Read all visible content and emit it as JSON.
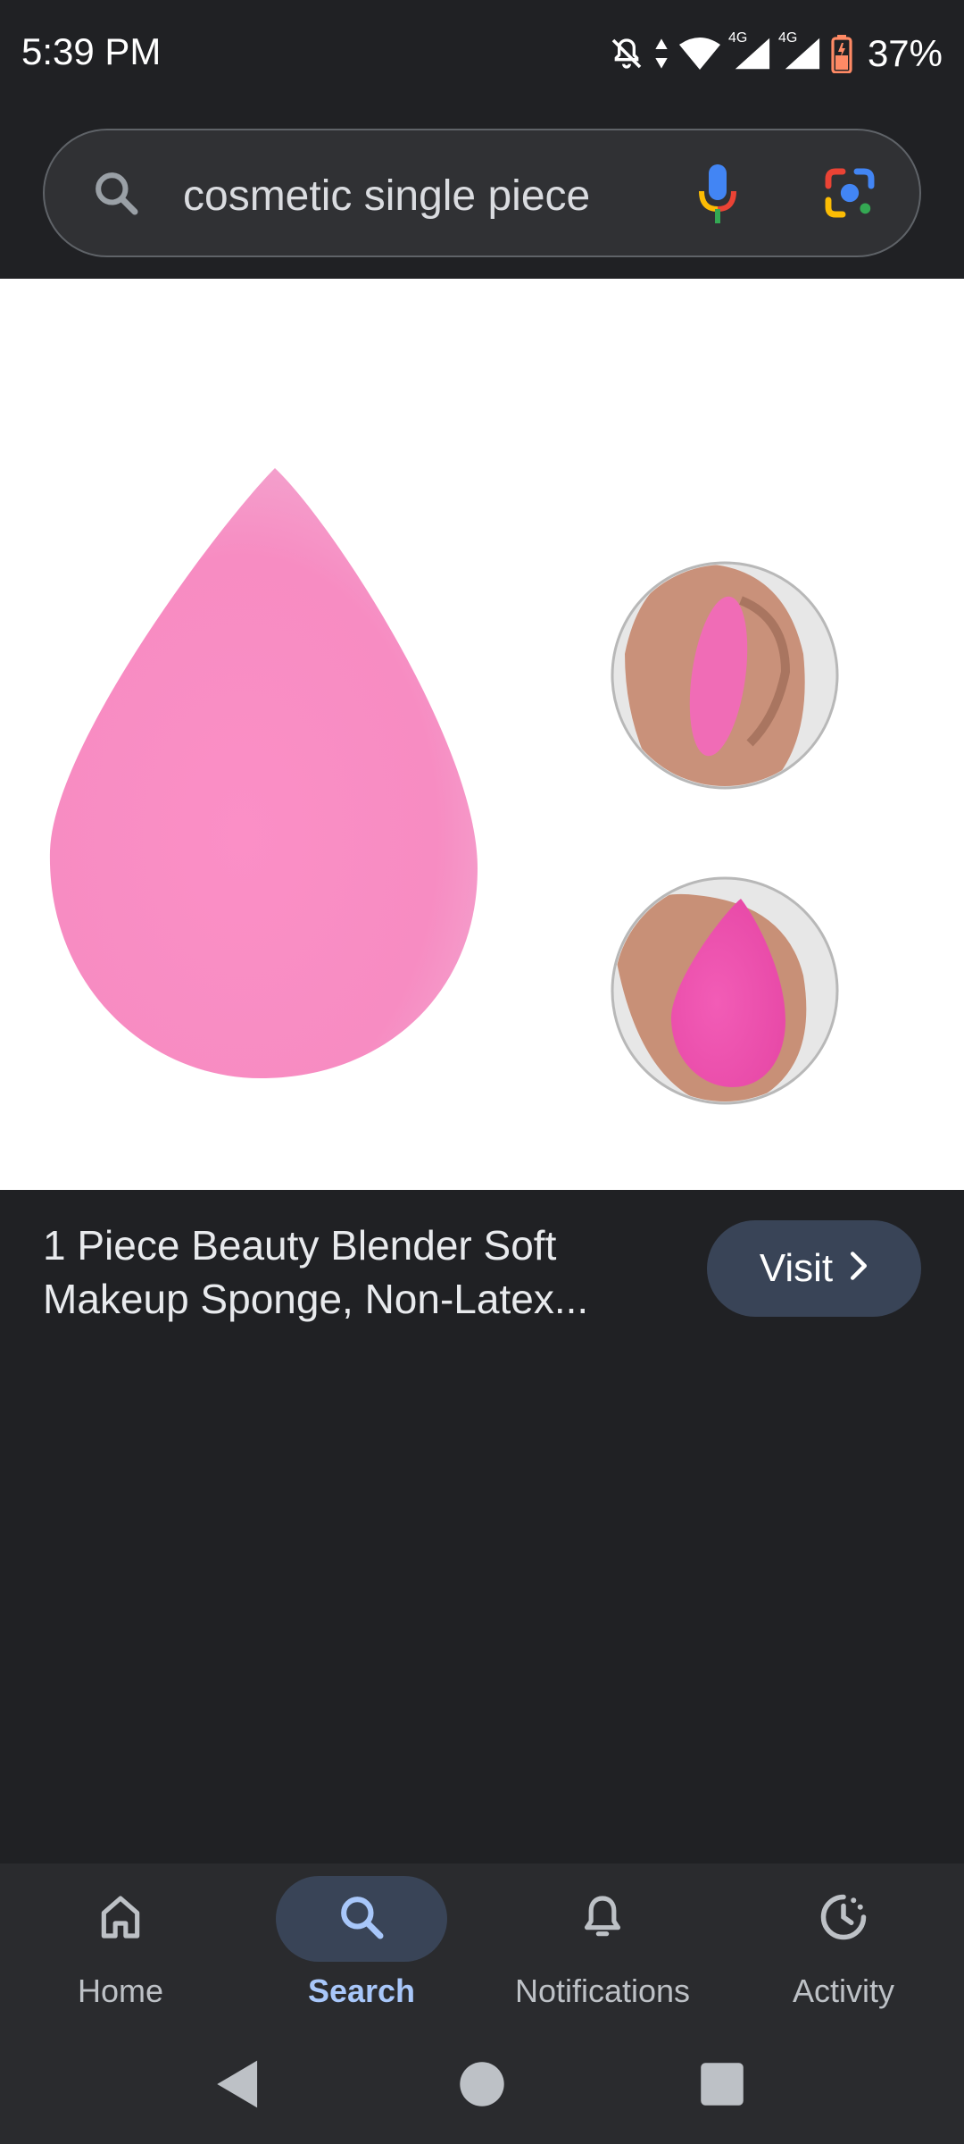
{
  "status_bar": {
    "time": "5:39 PM",
    "battery_percent": "37%",
    "network_1": "4G",
    "network_2": "4G",
    "icons": [
      "do-not-disturb-bell-icon",
      "data-arrows-icon",
      "wifi-icon",
      "signal-icon",
      "signal-icon",
      "battery-icon"
    ]
  },
  "search": {
    "query": "cosmetic single piece",
    "icons": [
      "search-icon",
      "mic-icon",
      "google-lens-icon"
    ]
  },
  "result": {
    "title": "1 Piece Beauty Blender Soft Makeup Sponge, Non-Latex...",
    "visit_label": "Visit"
  },
  "bottom_nav": {
    "items": [
      {
        "label": "Home",
        "icon": "home-icon",
        "active": false
      },
      {
        "label": "Search",
        "icon": "search-icon",
        "active": true
      },
      {
        "label": "Notifications",
        "icon": "bell-icon",
        "active": false
      },
      {
        "label": "Activity",
        "icon": "activity-icon",
        "active": false
      }
    ]
  },
  "system_nav": {
    "icons": [
      "back-icon",
      "home-circle-icon",
      "recents-icon"
    ]
  },
  "colors": {
    "background": "#202124",
    "sponge_pink": "#f78cc2",
    "active_nav": "#a8c7fa",
    "visit_button": "#394457"
  }
}
